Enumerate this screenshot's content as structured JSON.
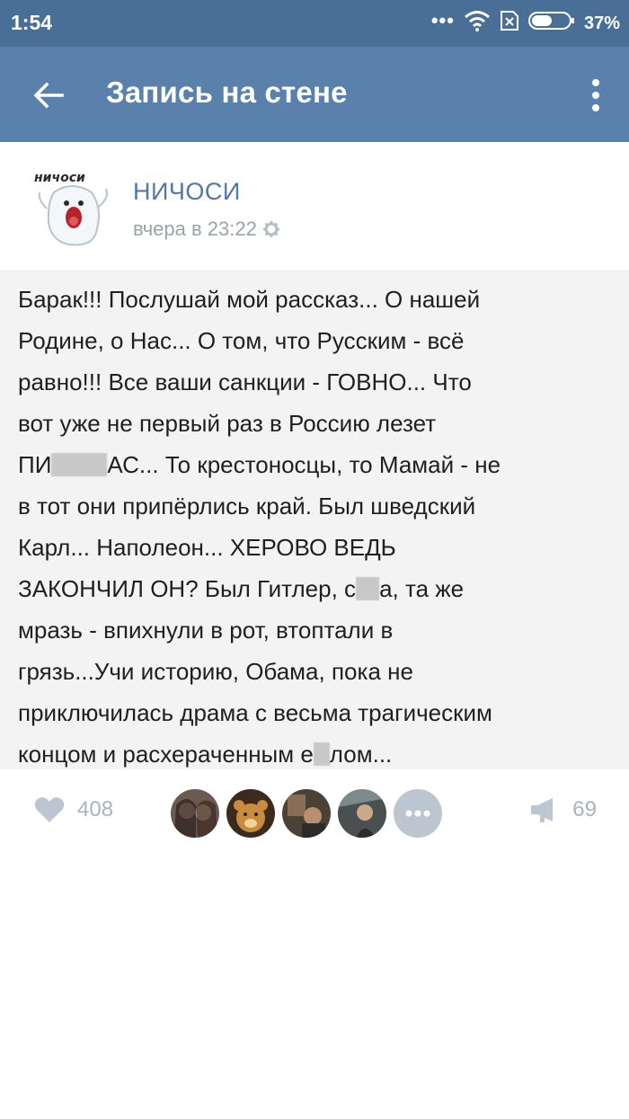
{
  "status_bar": {
    "time": "1:54",
    "battery": "37%",
    "icons": [
      "more-dots-icon",
      "wifi-icon",
      "sim-x-icon",
      "battery-icon"
    ]
  },
  "app_bar": {
    "title": "Запись на стене",
    "icons": [
      "back-arrow-icon",
      "more-vert-icon"
    ],
    "background": "#5a81ab"
  },
  "post": {
    "author": "НИЧОСИ",
    "avatar_caption": "ничоси",
    "time": "вчера в 23:22",
    "text_lines": [
      "Барак!!! Послушай мой рассказ... О нашей",
      "Родине, о Нас... О том, что Русским - всё",
      "равно!!! Все ваши санкции - ГОВНО... Что",
      "вот уже не первый раз в Россию лезет",
      "ПИ",
      "АС... То крестоносцы, то Мамай - не",
      "в тот они припёрлись край. Был шведский",
      "Карл... Наполеон... ХЕРОВО ВЕДЬ",
      "ЗАКОНЧИЛ ОН? Был Гитлер, с",
      "а, та же",
      "мразь - впихнули в рот, втоптали в",
      "грязь...Учи историю, Обама, пока не",
      "приключилась драма с весьма трагическим",
      "концом и расхераченным е",
      "лом..."
    ]
  },
  "actions": {
    "likes": "408",
    "shares": "69",
    "icons": [
      "heart-icon",
      "more-likers-icon",
      "megaphone-icon"
    ]
  },
  "colors": {
    "status_bar": "#4a6f97",
    "accent": "#5a81ab",
    "author_link": "#4f78a6",
    "muted": "#a9b3bd"
  }
}
